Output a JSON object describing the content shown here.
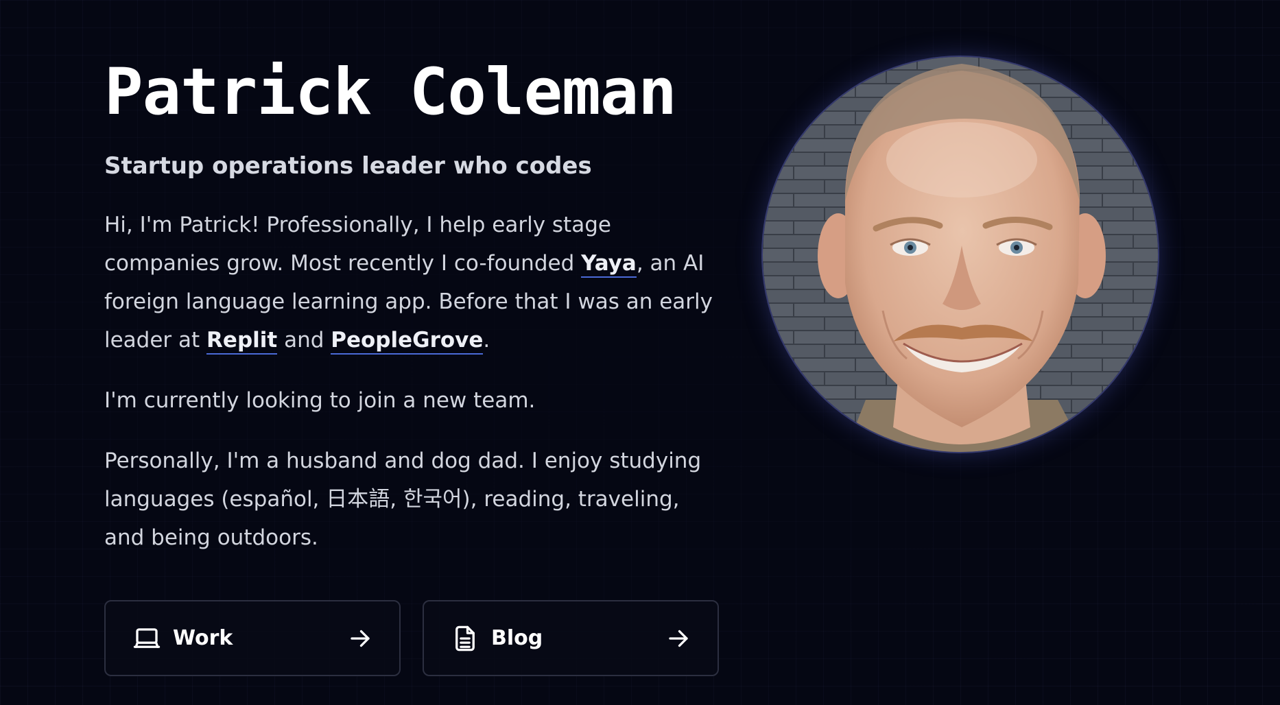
{
  "profile": {
    "name": "Patrick Coleman",
    "tagline": "Startup operations leader who codes"
  },
  "about": {
    "p1_part1": "Hi, I'm Patrick! Professionally, I help early stage companies grow. Most recently I co-founded ",
    "link_yaya": "Yaya",
    "p1_part2": ", an AI foreign language learning app. Before that I was an early leader at ",
    "link_replit": "Replit",
    "p1_part3": " and ",
    "link_peoplegrove": "PeopleGrove",
    "p1_part4": ".",
    "p2": "I'm currently looking to join a new team.",
    "p3": "Personally, I'm a husband and dog dad. I enjoy studying languages (español, 日本語, 한국어), reading, traveling, and being outdoors."
  },
  "nav": {
    "work": {
      "label": "Work",
      "icon": "laptop-icon"
    },
    "blog": {
      "label": "Blog",
      "icon": "document-icon"
    }
  },
  "colors": {
    "background": "#050713",
    "link_underline": "#4b6ad8",
    "button_border": "#2c2f40"
  }
}
